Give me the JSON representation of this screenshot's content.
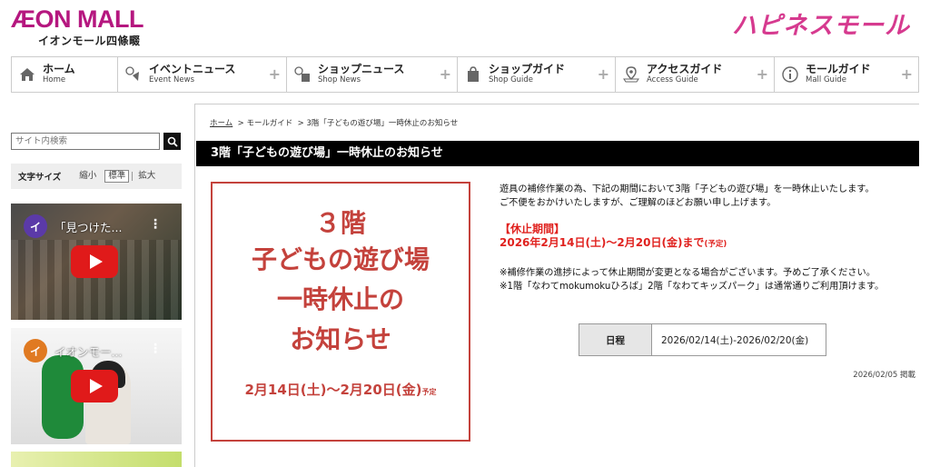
{
  "header": {
    "logo_main": "ÆON MALL",
    "logo_sub": "イオンモール四條畷",
    "happiness_mall": "ハピネスモール"
  },
  "nav": [
    {
      "ja": "ホーム",
      "en": "Home",
      "icon": "home-icon"
    },
    {
      "ja": "イベントニュース",
      "en": "Event News",
      "icon": "event-icon"
    },
    {
      "ja": "ショップニュース",
      "en": "Shop News",
      "icon": "shop-news-icon"
    },
    {
      "ja": "ショップガイド",
      "en": "Shop Guide",
      "icon": "shop-guide-icon"
    },
    {
      "ja": "アクセスガイド",
      "en": "Access Guide",
      "icon": "map-pin-icon"
    },
    {
      "ja": "モールガイド",
      "en": "Mall Guide",
      "icon": "info-icon"
    }
  ],
  "sidebar": {
    "search_placeholder": "サイト内検索",
    "font_size_label": "文字サイズ",
    "font_size_options": [
      "縮小",
      "標準",
      "拡大"
    ],
    "videos": [
      {
        "avatar": "イ",
        "title": "「見つけた..."
      },
      {
        "avatar": "イ",
        "title": "イオンモー..."
      }
    ]
  },
  "breadcrumb": {
    "home": "ホーム",
    "level2": "> モールガイド",
    "current": "> 3階「子どもの遊び場」一時休止のお知らせ"
  },
  "article": {
    "title": "3階「子どもの遊び場」一時休止のお知らせ",
    "poster": {
      "line1": "３階",
      "line2": "子どもの遊び場",
      "line3": "一時休止の",
      "line4": "お知らせ",
      "date": "2月14日(土)～2月20日(金)",
      "date_note": "予定"
    },
    "intro_1": "遊具の補修作業の為、下記の期間において3階「子どもの遊び場」を一時休止いたします。",
    "intro_2": "ご不便をおかけいたしますが、ご理解のほどお願い申し上げます。",
    "period_heading": "【休止期間】",
    "period_dates": "2026年2月14日(土)～2月20日(金)まで",
    "period_note": "(予定)",
    "note_1": "※補修作業の進捗によって休止期間が変更となる場合がございます。予めご了承ください。",
    "note_2": "※1階「なわてmokumokuひろば」2階「なわてキッズパーク」は通常通りご利用頂けます。",
    "schedule_label": "日程",
    "schedule_value": "2026/02/14(土)-2026/02/20(金)",
    "posted": "2026/02/05 掲載"
  },
  "colors": {
    "brand": "#b5177f",
    "alert_red": "#e0221f",
    "poster_red": "#c4423c"
  }
}
